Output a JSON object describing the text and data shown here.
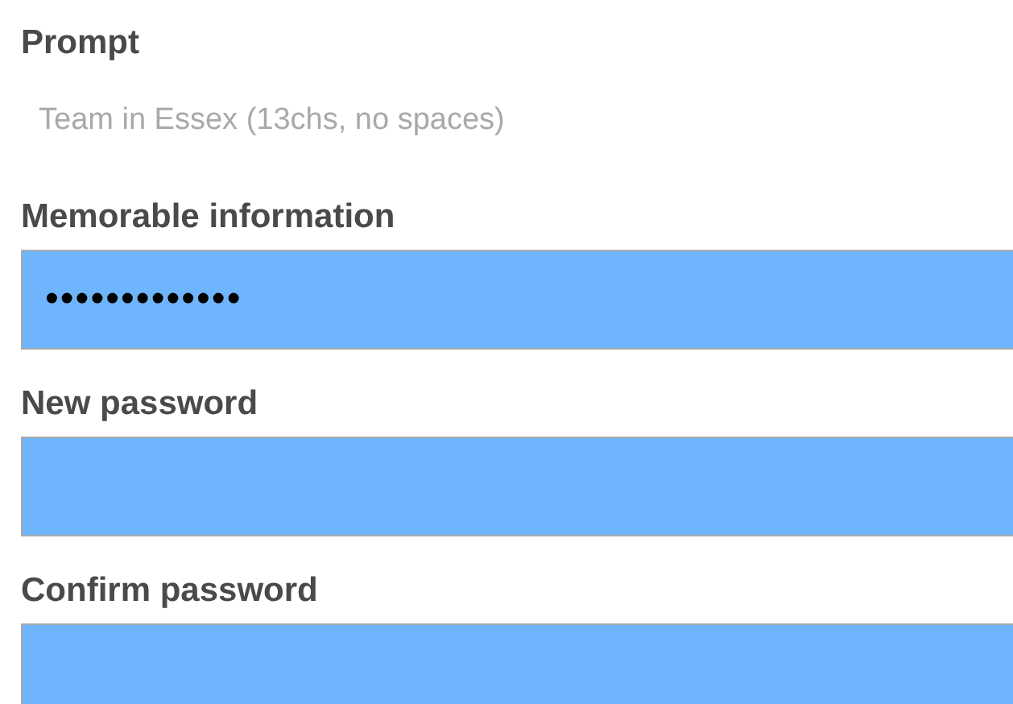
{
  "prompt": {
    "label": "Prompt",
    "value": "Team in Essex (13chs, no spaces)"
  },
  "fields": [
    {
      "label": "Memorable information",
      "value": "•••••••••••••"
    },
    {
      "label": "New password"
    },
    {
      "label": "Confirm password"
    }
  ]
}
